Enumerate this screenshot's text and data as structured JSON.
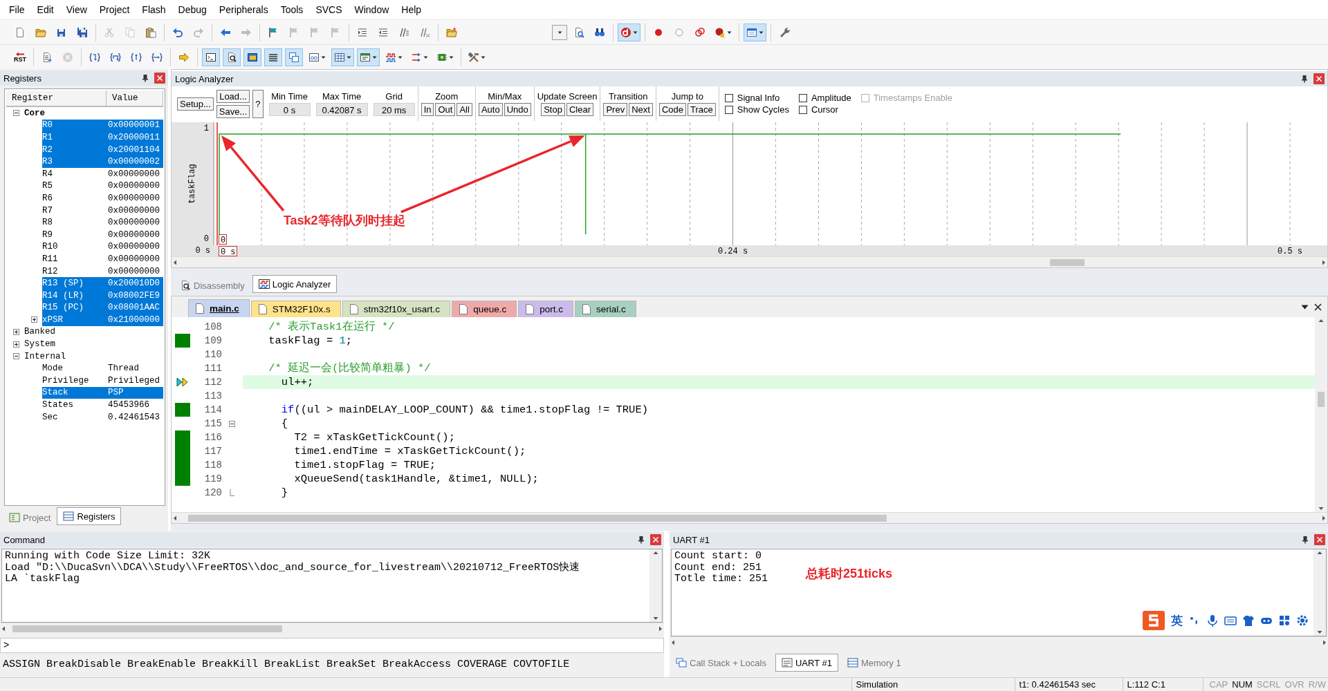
{
  "menu": [
    "File",
    "Edit",
    "View",
    "Project",
    "Flash",
    "Debug",
    "Peripherals",
    "Tools",
    "SVCS",
    "Window",
    "Help"
  ],
  "toolbar_1": [
    [
      {
        "kind": "new-file",
        "on": false,
        "dropdown": false,
        "disabled": false
      },
      {
        "kind": "open",
        "on": false,
        "dropdown": false,
        "disabled": false
      },
      {
        "kind": "save",
        "on": false,
        "dropdown": false,
        "disabled": false
      },
      {
        "kind": "save-all",
        "on": false,
        "dropdown": false,
        "disabled": false
      }
    ],
    [
      {
        "kind": "cut",
        "on": false,
        "dropdown": false,
        "disabled": true
      },
      {
        "kind": "copy",
        "on": false,
        "dropdown": false,
        "disabled": true
      },
      {
        "kind": "paste",
        "on": false,
        "dropdown": false,
        "disabled": false
      }
    ],
    [
      {
        "kind": "undo",
        "on": false,
        "dropdown": false,
        "disabled": false
      },
      {
        "kind": "redo",
        "on": false,
        "dropdown": false,
        "disabled": true
      }
    ],
    [
      {
        "kind": "back",
        "on": false,
        "dropdown": false,
        "disabled": false
      },
      {
        "kind": "forward",
        "on": false,
        "dropdown": false,
        "disabled": true
      }
    ],
    [
      {
        "kind": "bookmark",
        "on": false,
        "dropdown": false,
        "disabled": false
      },
      {
        "kind": "bookmark",
        "on": false,
        "dropdown": false,
        "disabled": true
      },
      {
        "kind": "bookmark",
        "on": false,
        "dropdown": false,
        "disabled": true
      },
      {
        "kind": "bookmark",
        "on": false,
        "dropdown": false,
        "disabled": true
      }
    ],
    [
      {
        "kind": "indent",
        "on": false,
        "dropdown": false,
        "disabled": false
      },
      {
        "kind": "unindent",
        "on": false,
        "dropdown": false,
        "disabled": false
      },
      {
        "kind": "comment",
        "on": false,
        "dropdown": false,
        "disabled": false
      },
      {
        "kind": "uncomment",
        "on": false,
        "dropdown": false,
        "disabled": false
      }
    ],
    [
      {
        "kind": "open-folder",
        "on": false,
        "dropdown": false,
        "disabled": false
      }
    ],
    [
      {
        "kind": "combo",
        "on": false,
        "dropdown": true,
        "disabled": false
      },
      {
        "kind": "find",
        "on": false,
        "dropdown": false,
        "disabled": false
      },
      {
        "kind": "incremental-find",
        "on": false,
        "dropdown": false,
        "disabled": false
      }
    ],
    [
      {
        "kind": "debug",
        "on": true,
        "dropdown": true,
        "disabled": false
      }
    ],
    [
      {
        "kind": "breakpoint",
        "on": false,
        "dropdown": false,
        "disabled": false
      },
      {
        "kind": "breakpoint-off",
        "on": false,
        "dropdown": false,
        "disabled": false
      },
      {
        "kind": "breakpoint-clear",
        "on": false,
        "dropdown": false,
        "disabled": false
      },
      {
        "kind": "breakpoint-kill",
        "on": false,
        "dropdown": true,
        "disabled": false
      }
    ],
    [
      {
        "kind": "window",
        "on": true,
        "dropdown": true,
        "disabled": false
      }
    ],
    [
      {
        "kind": "wrench",
        "on": false,
        "dropdown": false,
        "disabled": false
      }
    ]
  ],
  "toolbar_2": [
    [
      {
        "kind": "reset",
        "label": "RST",
        "on": false,
        "dropdown": false,
        "disabled": false
      }
    ],
    [
      {
        "kind": "step-list",
        "on": false,
        "dropdown": false,
        "disabled": false
      },
      {
        "kind": "stop",
        "on": false,
        "dropdown": false,
        "disabled": true
      }
    ],
    [
      {
        "kind": "step-into",
        "on": false,
        "dropdown": false,
        "disabled": false
      },
      {
        "kind": "step-over",
        "on": false,
        "dropdown": false,
        "disabled": false
      },
      {
        "kind": "step-out",
        "on": false,
        "dropdown": false,
        "disabled": false
      },
      {
        "kind": "run-to-cursor",
        "on": false,
        "dropdown": false,
        "disabled": false
      }
    ],
    [
      {
        "kind": "show-next",
        "on": false,
        "dropdown": false,
        "disabled": false
      }
    ],
    [
      {
        "kind": "command-window",
        "on": true,
        "dropdown": false,
        "disabled": false
      },
      {
        "kind": "disassembly",
        "on": true,
        "dropdown": false,
        "disabled": false
      },
      {
        "kind": "symbols",
        "on": true,
        "dropdown": false,
        "disabled": false
      },
      {
        "kind": "registers-window",
        "on": true,
        "dropdown": false,
        "disabled": false
      },
      {
        "kind": "call-stack",
        "on": true,
        "dropdown": false,
        "disabled": false
      },
      {
        "kind": "watch",
        "on": false,
        "dropdown": true,
        "disabled": false
      },
      {
        "kind": "memory",
        "on": true,
        "dropdown": true,
        "disabled": false
      },
      {
        "kind": "serial",
        "on": true,
        "dropdown": true,
        "disabled": false
      },
      {
        "kind": "analysis",
        "on": false,
        "dropdown": true,
        "disabled": false
      },
      {
        "kind": "trace",
        "on": false,
        "dropdown": true,
        "disabled": false
      },
      {
        "kind": "system-viewer",
        "on": false,
        "dropdown": true,
        "disabled": false
      }
    ],
    [
      {
        "kind": "toolbox",
        "on": false,
        "dropdown": true,
        "disabled": false
      }
    ]
  ],
  "registers": {
    "title": "Registers",
    "columns": [
      "Register",
      "Value"
    ],
    "tree": [
      {
        "name": "Core",
        "emphasized": true,
        "expanded": true,
        "selected": false,
        "children": [
          {
            "name": "R0",
            "value": "0x00000001",
            "selected": true
          },
          {
            "name": "R1",
            "value": "0x20000011",
            "selected": true
          },
          {
            "name": "R2",
            "value": "0x20001104",
            "selected": true
          },
          {
            "name": "R3",
            "value": "0x00000002",
            "selected": true
          },
          {
            "name": "R4",
            "value": "0x00000000",
            "selected": false
          },
          {
            "name": "R5",
            "value": "0x00000000",
            "selected": false
          },
          {
            "name": "R6",
            "value": "0x00000000",
            "selected": false
          },
          {
            "name": "R7",
            "value": "0x00000000",
            "selected": false
          },
          {
            "name": "R8",
            "value": "0x00000000",
            "selected": false
          },
          {
            "name": "R9",
            "value": "0x00000000",
            "selected": false
          },
          {
            "name": "R10",
            "value": "0x00000000",
            "selected": false
          },
          {
            "name": "R11",
            "value": "0x00000000",
            "selected": false
          },
          {
            "name": "R12",
            "value": "0x00000000",
            "selected": false
          },
          {
            "name": "R13 (SP)",
            "value": "0x200010D0",
            "selected": true
          },
          {
            "name": "R14 (LR)",
            "value": "0x08002FE9",
            "selected": true
          },
          {
            "name": "R15 (PC)",
            "value": "0x08001AAC",
            "selected": true
          },
          {
            "name": "xPSR",
            "value": "0x21000000",
            "selected": true,
            "expanded": false
          }
        ]
      },
      {
        "name": "Banked",
        "emphasized": false,
        "expanded": false,
        "selected": false
      },
      {
        "name": "System",
        "emphasized": false,
        "expanded": false,
        "selected": false
      },
      {
        "name": "Internal",
        "emphasized": false,
        "expanded": true,
        "selected": false,
        "children": [
          {
            "name": "Mode",
            "value": "Thread",
            "selected": false
          },
          {
            "name": "Privilege",
            "value": "Privileged",
            "selected": false
          },
          {
            "name": "Stack",
            "value": "PSP",
            "selected": true
          },
          {
            "name": "States",
            "value": "45453966",
            "selected": false
          },
          {
            "name": "Sec",
            "value": "0.42461543",
            "selected": false
          }
        ]
      }
    ],
    "tabs": [
      {
        "label": "Project",
        "selected": false
      },
      {
        "label": "Registers",
        "selected": true
      }
    ]
  },
  "logic_analyzer": {
    "title": "Logic Analyzer",
    "setup_button": "Setup...",
    "load_button": "Load...",
    "save_button": "Save...",
    "help_button": "?",
    "fields": [
      {
        "label": "Min Time",
        "value": "0 s"
      },
      {
        "label": "Max Time",
        "value": "0.42087 s"
      },
      {
        "label": "Grid",
        "value": "20 ms"
      }
    ],
    "button_groups": [
      {
        "label": "Zoom",
        "buttons": [
          "In",
          "Out",
          "All"
        ]
      },
      {
        "label": "Min/Max",
        "buttons": [
          "Auto",
          "Undo"
        ]
      },
      {
        "label": "Update Screen",
        "buttons": [
          "Stop",
          "Clear"
        ]
      },
      {
        "label": "Transition",
        "buttons": [
          "Prev",
          "Next"
        ]
      },
      {
        "label": "Jump to",
        "buttons": [
          "Code",
          "Trace"
        ]
      }
    ],
    "options": [
      {
        "label": "Signal Info",
        "checked": false,
        "disabled": false
      },
      {
        "label": "Amplitude",
        "checked": false,
        "disabled": false
      },
      {
        "label": "Timestamps Enable",
        "checked": false,
        "disabled": true
      },
      {
        "label": "Show Cycles",
        "checked": false,
        "disabled": false
      },
      {
        "label": "Cursor",
        "checked": false,
        "disabled": false
      }
    ],
    "signal": {
      "name": "taskFlag",
      "high_label": "1",
      "low_label": "0"
    },
    "axis": {
      "start": "0 s",
      "cursor": "0 s",
      "cursor_value": "0",
      "ticks": [
        "0.24 s",
        "0.5 s"
      ]
    },
    "annotation": "Task2等待队列时挂起"
  },
  "view_tabs": [
    {
      "label": "Disassembly",
      "selected": false
    },
    {
      "label": "Logic Analyzer",
      "selected": true
    }
  ],
  "editor": {
    "tabs": [
      {
        "label": "main.c",
        "selected": true,
        "color": "#c6d6f0"
      },
      {
        "label": "STM32F10x.s",
        "selected": false,
        "color": "#ffe38a"
      },
      {
        "label": "stm32f10x_usart.c",
        "selected": false,
        "color": "#d6e3c3"
      },
      {
        "label": "queue.c",
        "selected": false,
        "color": "#f0a9a9"
      },
      {
        "label": "port.c",
        "selected": false,
        "color": "#cbbbea"
      },
      {
        "label": "serial.c",
        "selected": false,
        "color": "#a9cfc0"
      }
    ],
    "lines": [
      {
        "number": "108",
        "covered": false,
        "current": false,
        "fold_start": false,
        "fold_end": false,
        "parts": [
          {
            "text": "    /* 表示Task1在运行 */",
            "kind": "comment"
          }
        ]
      },
      {
        "number": "109",
        "covered": true,
        "current": false,
        "fold_start": false,
        "fold_end": false,
        "parts": [
          {
            "text": "    taskFlag = ",
            "kind": "plain"
          },
          {
            "text": "1",
            "kind": "number"
          },
          {
            "text": ";",
            "kind": "plain"
          }
        ]
      },
      {
        "number": "110",
        "covered": false,
        "current": false,
        "fold_start": false,
        "fold_end": false
      },
      {
        "number": "111",
        "covered": false,
        "current": false,
        "fold_start": false,
        "fold_end": false,
        "parts": [
          {
            "text": "    /* 延迟一会(比较简单粗暴) */",
            "kind": "comment"
          }
        ]
      },
      {
        "number": "112",
        "covered": false,
        "current": true,
        "fold_start": false,
        "fold_end": false,
        "parts": [
          {
            "text": "      ul++;",
            "kind": "plain"
          }
        ]
      },
      {
        "number": "113",
        "covered": false,
        "current": false,
        "fold_start": false,
        "fold_end": false
      },
      {
        "number": "114",
        "covered": true,
        "current": false,
        "fold_start": false,
        "fold_end": false,
        "parts": [
          {
            "text": "      if",
            "kind": "keyword"
          },
          {
            "text": "((ul > mainDELAY_LOOP_COUNT) && time1.stopFlag != TRUE)",
            "kind": "plain"
          }
        ]
      },
      {
        "number": "115",
        "covered": false,
        "current": false,
        "fold_start": true,
        "fold_end": false,
        "parts": [
          {
            "text": "      {",
            "kind": "plain"
          }
        ]
      },
      {
        "number": "116",
        "covered": true,
        "current": false,
        "fold_start": false,
        "fold_end": false,
        "parts": [
          {
            "text": "        T2 = xTaskGetTickCount();",
            "kind": "plain"
          }
        ]
      },
      {
        "number": "117",
        "covered": true,
        "current": false,
        "fold_start": false,
        "fold_end": false,
        "parts": [
          {
            "text": "        time1.endTime = xTaskGetTickCount();",
            "kind": "plain"
          }
        ]
      },
      {
        "number": "118",
        "covered": true,
        "current": false,
        "fold_start": false,
        "fold_end": false,
        "parts": [
          {
            "text": "        time1.stopFlag = TRUE;",
            "kind": "plain"
          }
        ]
      },
      {
        "number": "119",
        "covered": true,
        "current": false,
        "fold_start": false,
        "fold_end": false,
        "parts": [
          {
            "text": "        xQueueSend(task1Handle, &time1, NULL);",
            "kind": "plain"
          }
        ]
      },
      {
        "number": "120",
        "covered": false,
        "current": false,
        "fold_start": false,
        "fold_end": true,
        "parts": [
          {
            "text": "      }",
            "kind": "plain"
          }
        ]
      }
    ]
  },
  "command": {
    "title": "Command",
    "lines": [
      "Running with Code Size Limit: 32K",
      "Load \"D:\\\\DucaSvn\\\\DCA\\\\Study\\\\FreeRTOS\\\\doc_and_source_for_livestream\\\\20210712_FreeRTOS快速",
      "LA `taskFlag"
    ],
    "prompt": ">",
    "help_line": "ASSIGN BreakDisable BreakEnable BreakKill BreakList BreakSet BreakAccess COVERAGE COVTOFILE"
  },
  "uart": {
    "title": "UART #1",
    "lines": [
      "Count start: 0",
      "Count end: 251",
      "Totle time: 251"
    ],
    "annotation": "总耗时251ticks",
    "ime_label": "英",
    "tabs": [
      {
        "label": "Call Stack + Locals",
        "selected": false
      },
      {
        "label": "UART #1",
        "selected": true
      },
      {
        "label": "Memory 1",
        "selected": false
      }
    ]
  },
  "status_bar": {
    "mode": "Simulation",
    "time": "t1: 0.42461543 sec",
    "position": "L:112 C:1",
    "indicators": [
      {
        "label": "CAP",
        "on": false
      },
      {
        "label": "NUM",
        "on": true
      },
      {
        "label": "SCRL",
        "on": false
      },
      {
        "label": "OVR",
        "on": false
      },
      {
        "label": "R/W",
        "on": false
      }
    ]
  }
}
